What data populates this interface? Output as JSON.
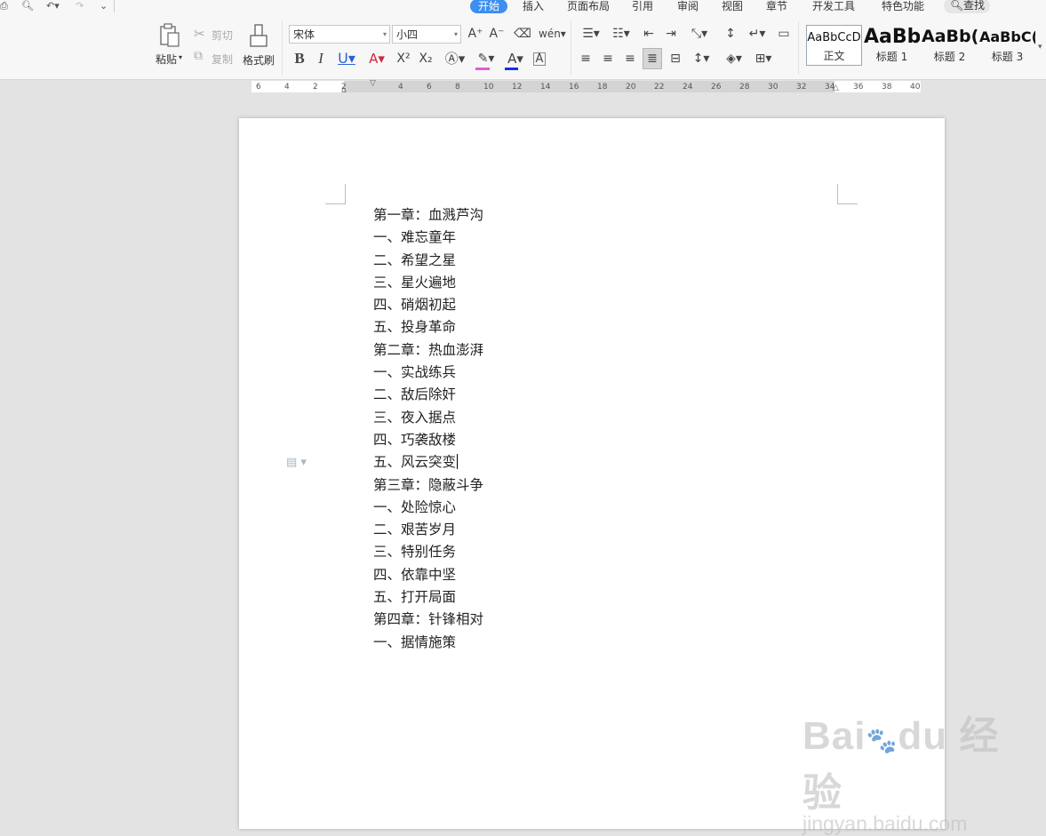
{
  "quick_access": {
    "icons": [
      "print-icon",
      "print-preview-icon",
      "undo-icon",
      "redo-icon",
      "customize-icon"
    ]
  },
  "tabs": [
    {
      "label": "开始",
      "active": true
    },
    {
      "label": "插入"
    },
    {
      "label": "页面布局"
    },
    {
      "label": "引用"
    },
    {
      "label": "审阅"
    },
    {
      "label": "视图"
    },
    {
      "label": "章节"
    },
    {
      "label": "开发工具"
    },
    {
      "label": "特色功能"
    }
  ],
  "search": {
    "label": "查找"
  },
  "clipboard": {
    "paste": "粘贴",
    "cut": "剪切",
    "copy": "复制",
    "format_painter": "格式刷"
  },
  "font": {
    "name": "宋体",
    "size": "小四"
  },
  "styles": [
    {
      "sample": "AaBbCcD",
      "name": "正文",
      "selected": true
    },
    {
      "sample": "AaBb",
      "name": "标题 1"
    },
    {
      "sample": "AaBb(",
      "name": "标题 2"
    },
    {
      "sample": "AaBbC(",
      "name": "标题 3"
    }
  ],
  "ruler": {
    "ticks": [
      "6",
      "4",
      "2",
      "2",
      "4",
      "6",
      "8",
      "10",
      "12",
      "14",
      "16",
      "18",
      "20",
      "22",
      "24",
      "26",
      "28",
      "30",
      "32",
      "34",
      "36",
      "38",
      "40"
    ]
  },
  "document": {
    "lines": [
      "第一章：血溅芦沟",
      "一、难忘童年",
      "二、希望之星",
      "三、星火遍地",
      "四、硝烟初起",
      "五、投身革命",
      "第二章：热血澎湃",
      "一、实战练兵",
      "二、敌后除奸",
      "三、夜入据点",
      "四、巧袭敌楼",
      "五、风云突变",
      "第三章：隐蔽斗争",
      "一、处险惊心",
      "二、艰苦岁月",
      "三、特别任务",
      "四、依靠中坚",
      "五、打开局面",
      "第四章：针锋相对",
      "一、据情施策"
    ],
    "caret_line": 11
  },
  "watermark": {
    "logo": "Bai du 经验",
    "url": "jingyan.baidu.com"
  },
  "colors": {
    "accent": "#3d8ef1",
    "highlight": "#e85ad0",
    "font_color": "#1a2fe0",
    "font_color_a": "#d0283a"
  }
}
